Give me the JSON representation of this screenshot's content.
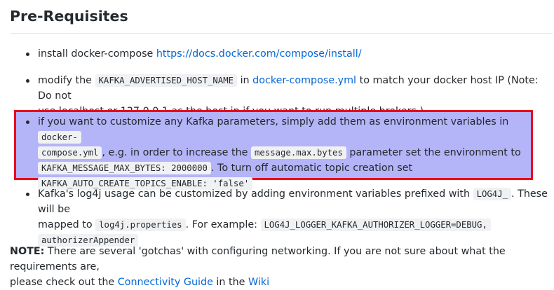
{
  "heading": "Pre-Requisites",
  "item1": {
    "text": "install docker-compose ",
    "link": "https://docs.docker.com/compose/install/"
  },
  "item2": {
    "t1": "modify the ",
    "code1": "KAFKA_ADVERTISED_HOST_NAME",
    "t2": " in ",
    "link": "docker-compose.yml",
    "t3": " to match your docker host IP (Note: Do not",
    "t4": "use localhost or 127.0.0.1 as the host ip if you want to run multiple brokers.)"
  },
  "item3": {
    "t1": "if you want to customize any Kafka parameters, simply add them as environment variables in ",
    "code1a": "docker-",
    "code1b": "compose.yml",
    "t2": ", e.g. in order to increase the ",
    "code2": "message.max.bytes",
    "t3": " parameter set the environment to",
    "code3": "KAFKA_MESSAGE_MAX_BYTES: 2000000",
    "t4": ". To turn off automatic topic creation set",
    "code4": "KAFKA_AUTO_CREATE_TOPICS_ENABLE: 'false'"
  },
  "item4": {
    "t1": "Kafka's log4j usage can be customized by adding environment variables prefixed with ",
    "code1": "LOG4J_",
    "t2": ". These will be",
    "t3": "mapped to ",
    "code2": "log4j.properties",
    "t4": ". For example: ",
    "code3": "LOG4J_LOGGER_KAFKA_AUTHORIZER_LOGGER=DEBUG,",
    "code4": "authorizerAppender"
  },
  "note": {
    "label": "NOTE:",
    "t1": " There are several 'gotchas' with configuring networking. If you are not sure about what the requirements are,",
    "t2": "please check out the ",
    "link1": "Connectivity Guide",
    "t3": " in the ",
    "link2": "Wiki"
  },
  "colors": {
    "link": "#0366d6",
    "highlight_fill": "#b4b4f8",
    "highlight_border": "#e8001c",
    "code_bg": "#f0f1f3"
  }
}
